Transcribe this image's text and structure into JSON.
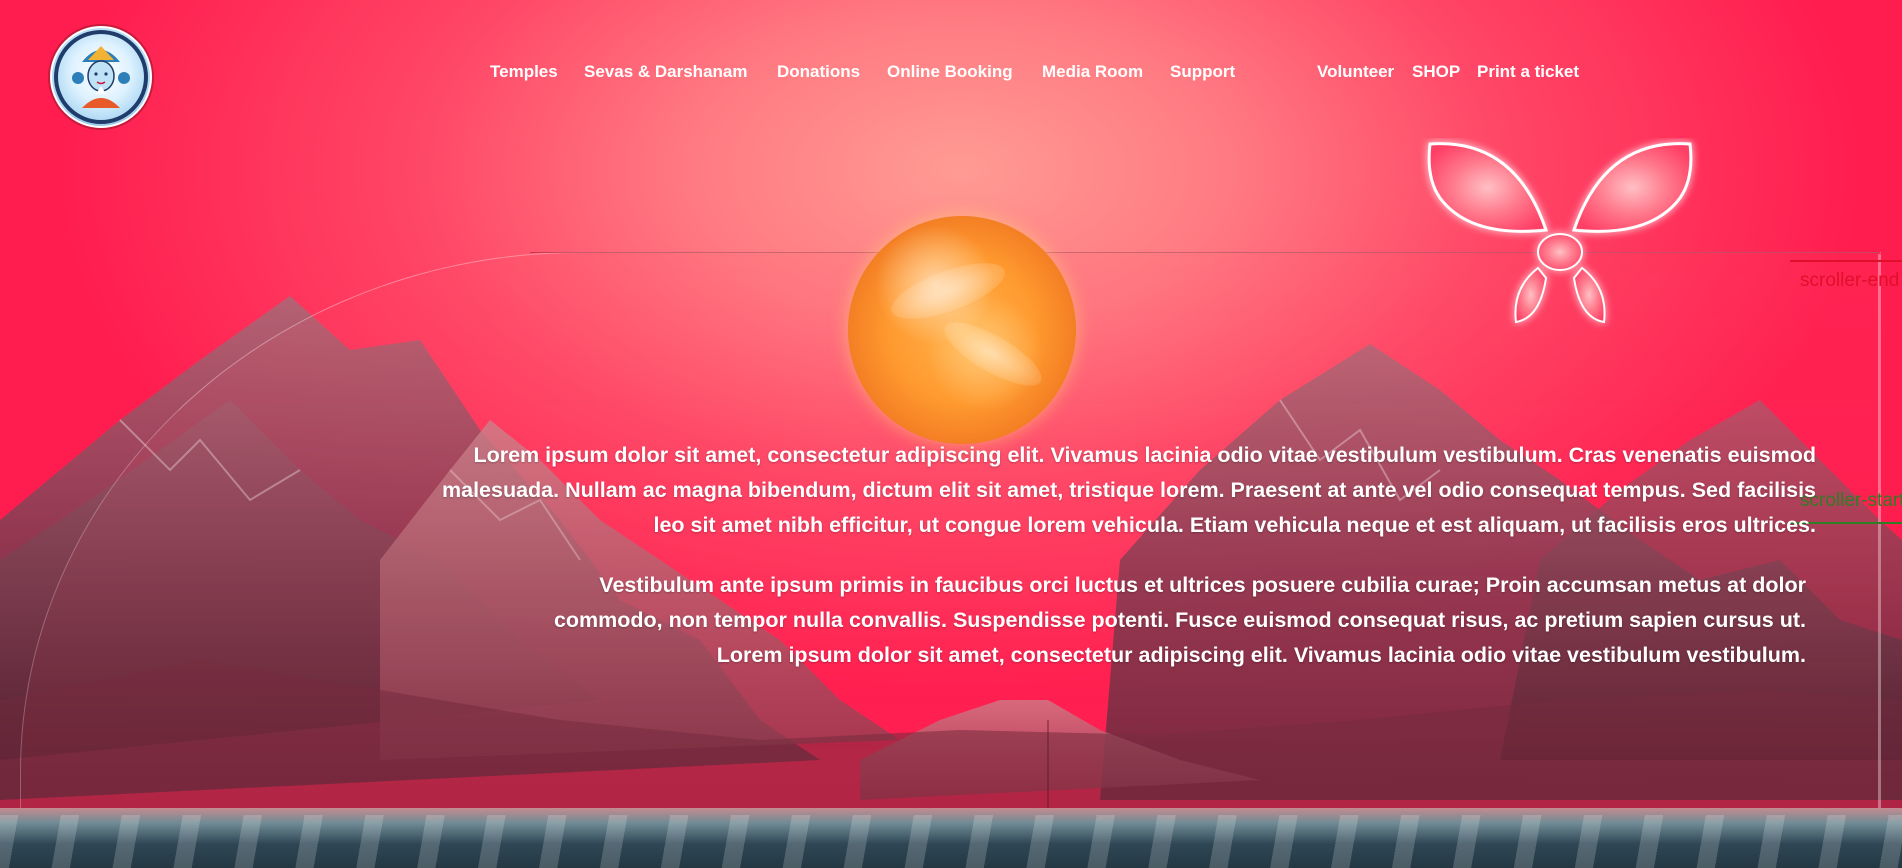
{
  "brand": {
    "logo_icon": "deity-logo-icon"
  },
  "nav": {
    "items": [
      {
        "label": "Temples"
      },
      {
        "label": "Sevas & Darshanam"
      },
      {
        "label": "Donations"
      },
      {
        "label": "Online Booking"
      },
      {
        "label": "Media Room"
      },
      {
        "label": "Support"
      },
      {
        "label": "Volunteer"
      },
      {
        "label": "SHOP"
      },
      {
        "label": "Print a ticket"
      }
    ]
  },
  "hero": {
    "paragraph_1": "Lorem ipsum dolor sit amet, consectetur adipiscing elit. Vivamus lacinia odio vitae vestibulum vestibulum. Cras venenatis euismod malesuada. Nullam ac magna bibendum, dictum elit sit amet, tristique lorem. Praesent at ante vel odio consequat tempus. Sed facilisis leo sit amet nibh efficitur, ut congue lorem vehicula. Etiam vehicula neque et est aliquam, ut facilisis eros ultrices.",
    "paragraph_2": "Vestibulum ante ipsum primis in faucibus orci luctus et ultrices posuere cubilia curae; Proin accumsan metus at dolor commodo, non tempor nulla convallis. Suspendisse potenti. Fusce euismod consequat risus, ac pretium sapien cursus ut. Lorem ipsum dolor sit amet, consectetur adipiscing elit. Vivamus lacinia odio vitae vestibulum vestibulum."
  },
  "debug_markers": {
    "scroller_end": "scroller-end",
    "scroller_start": "scroller-start"
  },
  "colors": {
    "background": "#ff1d4f",
    "nav_text": "#ffffff",
    "marker_end": "#e0102a",
    "marker_start": "#2f7d24"
  }
}
